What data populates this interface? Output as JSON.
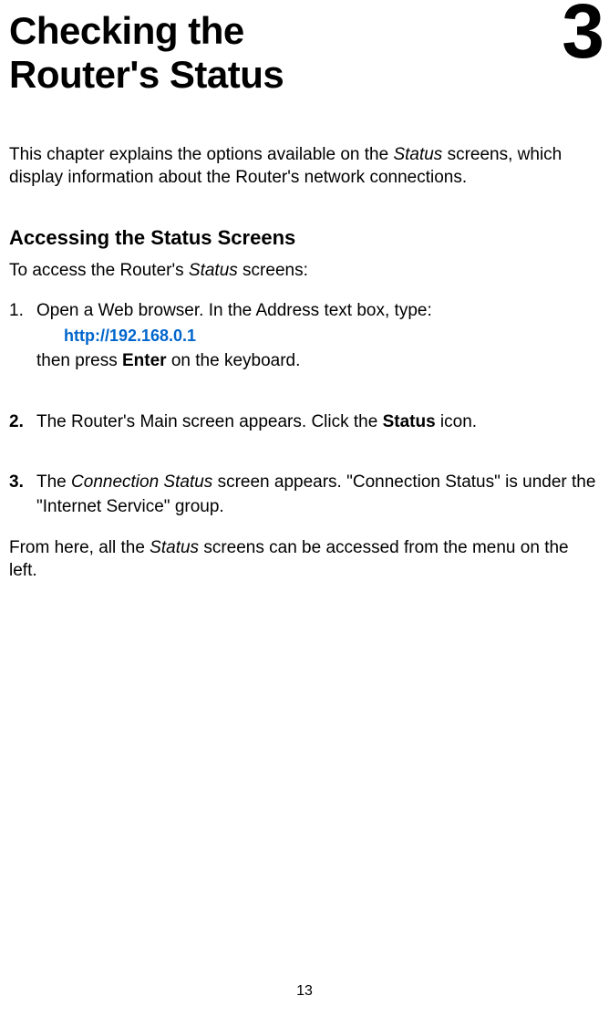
{
  "header": {
    "title_line1": "Checking the",
    "title_line2": "Router's Status",
    "chapter_number": "3"
  },
  "intro": {
    "text_before_italic": "This chapter explains the options available on the ",
    "italic_word": "Status",
    "text_after_italic": " screens, which display information about the Router's network connections."
  },
  "section": {
    "heading": "Accessing the Status Screens",
    "intro_before": "To access the Router's ",
    "intro_italic": "Status",
    "intro_after": " screens:"
  },
  "steps": {
    "step1": {
      "number": "1.",
      "line1": "Open a Web browser. In the Address text box, type:",
      "url": "http://192.168.0.1",
      "line2_before": "then press ",
      "line2_bold": "Enter",
      "line2_after": " on the keyboard."
    },
    "step2": {
      "number": "2.",
      "text_before": "The Router's Main screen appears. Click the ",
      "text_bold": "Status",
      "text_after": " icon."
    },
    "step3": {
      "number": "3.",
      "text_before": "The ",
      "text_italic": "Connection Status",
      "text_after": " screen appears. \"Connection Status\" is under the \"Internet Service\" group."
    }
  },
  "final": {
    "text_before": "From here, all the ",
    "text_italic": "Status",
    "text_after": " screens can be accessed from the menu on the left."
  },
  "page_number": "13"
}
